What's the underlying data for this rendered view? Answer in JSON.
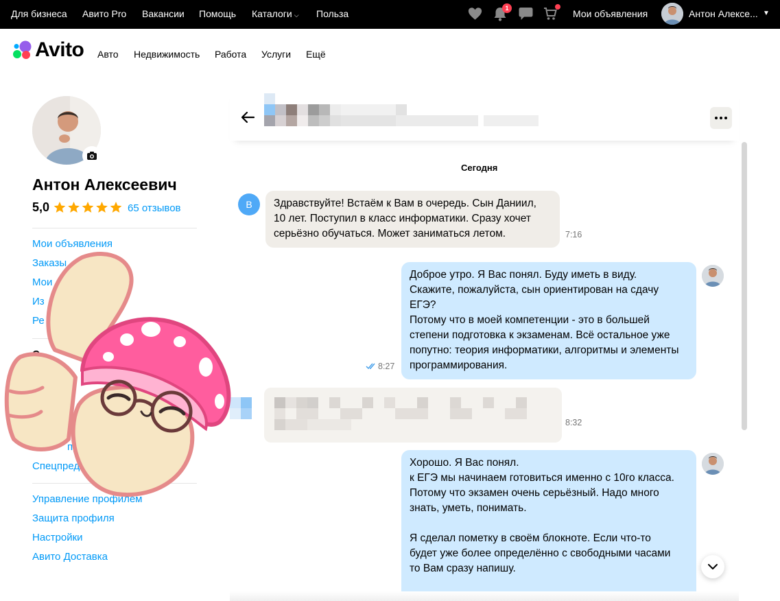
{
  "topbar": {
    "links": [
      "Для бизнеса",
      "Авито Pro",
      "Вакансии",
      "Помощь",
      "Каталоги",
      "Польза"
    ],
    "notifications_count": "1",
    "my_ads": "Мои объявления",
    "user_name": "Антон Алексе..."
  },
  "brand": {
    "logo_text": "Avito"
  },
  "nav": {
    "items": [
      "Авто",
      "Недвижимость",
      "Работа",
      "Услуги",
      "Ещё"
    ]
  },
  "profile": {
    "name": "Антон Алексеевич",
    "rating": "5,0",
    "rating_stars": 5,
    "reviews": "65 отзывов"
  },
  "sidebar": {
    "group1": [
      "Мои объявления",
      "Заказы",
      "Мои",
      "Из",
      "Ре"
    ],
    "group2_heading": "С",
    "group2": [
      "профи",
      "Спецпредл"
    ],
    "group3": [
      "Управление профилем",
      "Защита профиля",
      "Настройки",
      "Авито Доставка"
    ]
  },
  "chat": {
    "date_separator": "Сегодня",
    "contact_initial": "В",
    "messages": [
      {
        "direction": "in",
        "text": "Здравствуйте! Встаём к Вам в очередь. Сын Даниил,\n10 лет. Поступил в класс информатики. Сразу хочет\nсерьёзно обучаться. Может заниматься летом.",
        "time": "7:16"
      },
      {
        "direction": "out",
        "text": "Доброе утро. Я Вас понял. Буду иметь в виду.\nСкажите, пожалуйста, сын ориентирован на сдачу\nЕГЭ?\nПотому что в моей компетенции - это в большей\nстепени подготовка к экзаменам. Всё остальное уже\nпопутно: теория информатики, алгоритмы и элементы\nпрограммирования.",
        "time": "8:27",
        "read": true
      },
      {
        "direction": "in",
        "text": "",
        "time": "8:32",
        "blurred": true
      },
      {
        "direction": "out",
        "text": "Хорошо. Я Вас понял.\nк ЕГЭ мы начинаем готовиться именно с 10го класса.\nПотому что экзамен очень серьёзный. Надо много\nзнать, уметь, понимать.\n\nЯ сделал пометку в своём блокноте. Если что-то\nбудет уже более определённо с свободными часами\nто Вам сразу напишу.",
        "time": ""
      }
    ]
  },
  "colors": {
    "topbar": "#000000",
    "link": "#0099f7",
    "bubble_in": "#f0ede8",
    "bubble_out": "#cfeaff",
    "star": "#ffa800",
    "badge": "#ff4053"
  }
}
